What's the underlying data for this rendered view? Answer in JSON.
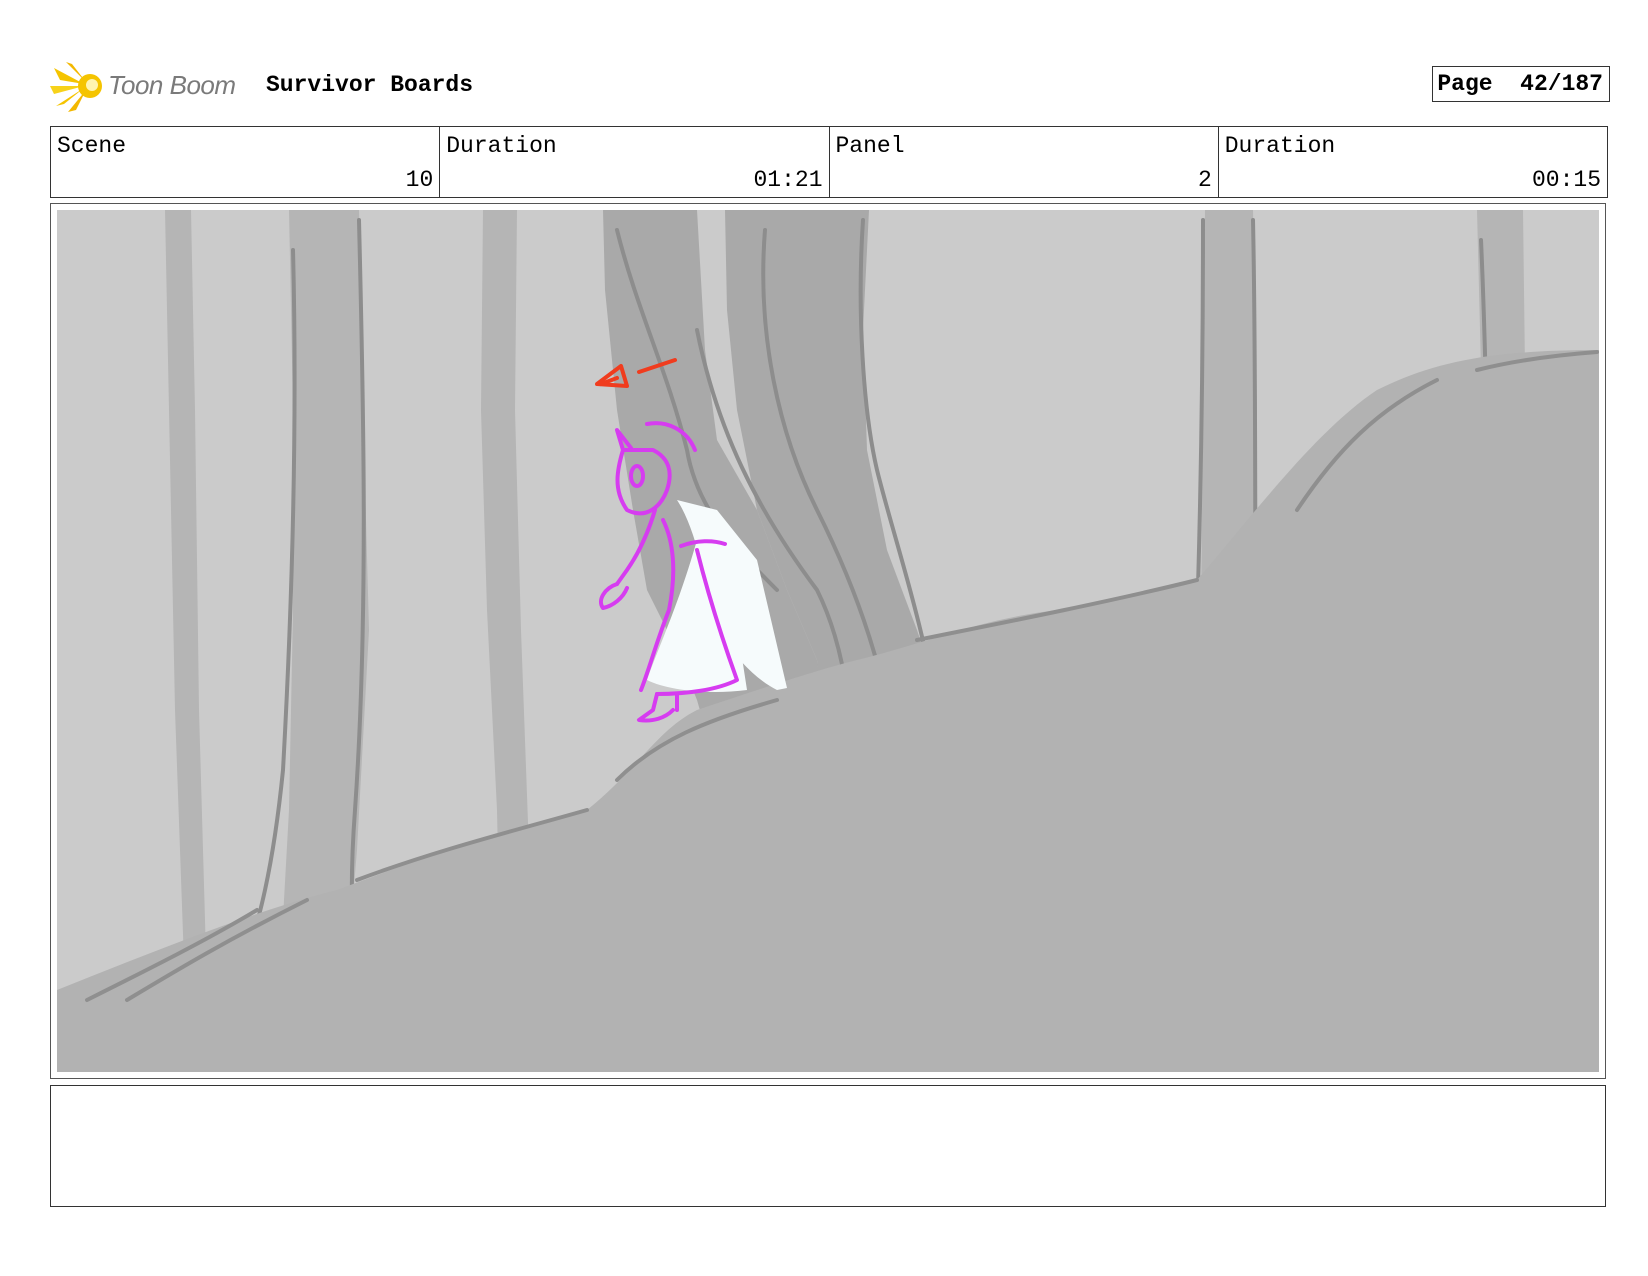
{
  "header": {
    "logo_text": "Toon Boom",
    "project_title": "Survivor Boards",
    "page_label": "Page",
    "page_number": "42/187"
  },
  "info": {
    "scene_label": "Scene",
    "scene_value": "10",
    "scene_duration_label": "Duration",
    "scene_duration_value": "01:21",
    "panel_label": "Panel",
    "panel_value": "2",
    "panel_duration_label": "Duration",
    "panel_duration_value": "00:15"
  },
  "colors": {
    "logo_yellow": "#f5c400",
    "sky_gray": "#cbcbcb",
    "tree_gray": "#a8a8a8",
    "ground_gray": "#b2b2b2",
    "character_magenta": "#d63cf0",
    "arrow_red": "#f03c1e"
  },
  "notes": {
    "text": ""
  }
}
